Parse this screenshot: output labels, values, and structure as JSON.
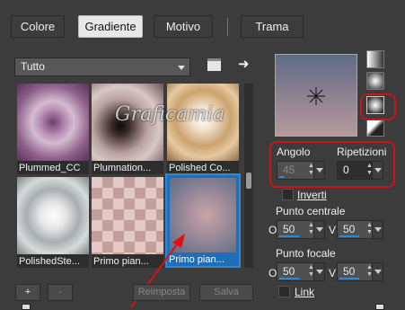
{
  "tabs": {
    "colore": "Colore",
    "gradiente": "Gradiente",
    "motivo": "Motivo",
    "trama": "Trama"
  },
  "library": {
    "category": "Tutto",
    "tiles": [
      {
        "label": "Plummed_CC"
      },
      {
        "label": "Plumnation..."
      },
      {
        "label": "Polished Co..."
      },
      {
        "label": "PolishedSte..."
      },
      {
        "label": "Primo pian..."
      },
      {
        "label": "Primo pian..."
      }
    ],
    "add_label": "+",
    "remove_label": "-",
    "reset_label": "Reimposta",
    "save_label": "Salva"
  },
  "watermark": "Graficamia",
  "options": {
    "angle_label": "Angolo",
    "angle_value": "45",
    "repeats_label": "Ripetizioni",
    "repeats_value": "0",
    "invert_label": "Inverti",
    "center_label": "Punto centrale",
    "center_o": "50",
    "center_v": "50",
    "focal_label": "Punto focale",
    "focal_o": "50",
    "focal_v": "50",
    "o_label": "O",
    "v_label": "V",
    "link_label": "Link"
  },
  "colors": {
    "accent": "#2f87d8",
    "highlight": "#d0121b"
  }
}
